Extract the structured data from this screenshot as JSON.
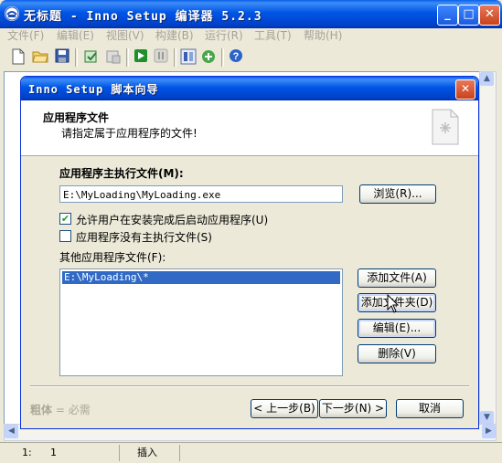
{
  "main_window": {
    "title": "无标题 - Inno Setup 编译器 5.2.3",
    "caption_buttons": {
      "minimize": "_",
      "maximize": "□",
      "close": "✕"
    }
  },
  "menu": [
    "文件(F)",
    "编辑(E)",
    "视图(V)",
    "构建(B)",
    "运行(R)",
    "工具(T)",
    "帮助(H)"
  ],
  "toolbar_icons": [
    "new-file-icon",
    "open-folder-icon",
    "save-icon",
    "compile-icon",
    "stop-compile-icon",
    "run-icon",
    "pause-icon",
    "target-icon",
    "wizard-icon",
    "help-icon"
  ],
  "status_bar": {
    "line": "1:",
    "col": "1",
    "mode": "插入"
  },
  "wizard": {
    "title": "Inno Setup 脚本向导",
    "header_title": "应用程序文件",
    "header_subtitle": "请指定属于应用程序的文件!",
    "main_exe_label": "应用程序主执行文件(M):",
    "main_exe_value": "E:\\MyLoading\\MyLoading.exe",
    "browse_button": "浏览(R)...",
    "checkbox_launch": {
      "label": "允许用户在安装完成后启动应用程序(U)",
      "checked": true
    },
    "checkbox_no_exe": {
      "label": "应用程序没有主执行文件(S)",
      "checked": false
    },
    "other_files_label": "其他应用程序文件(F):",
    "other_files": [
      "E:\\MyLoading\\*"
    ],
    "add_file_button": "添加文件(A)",
    "add_folder_button": "添加文件夹(D)",
    "edit_button": "编辑(E)...",
    "delete_button": "删除(V)",
    "bold_hint": {
      "bold": "粗体",
      "rest": "= 必需"
    },
    "back_button": "< 上一步(B)",
    "next_button": "下一步(N) >",
    "cancel_button": "取消"
  },
  "colors": {
    "titlebar": "#0055e5",
    "selection": "#316ac5",
    "dialog_bg": "#ece9d8"
  }
}
